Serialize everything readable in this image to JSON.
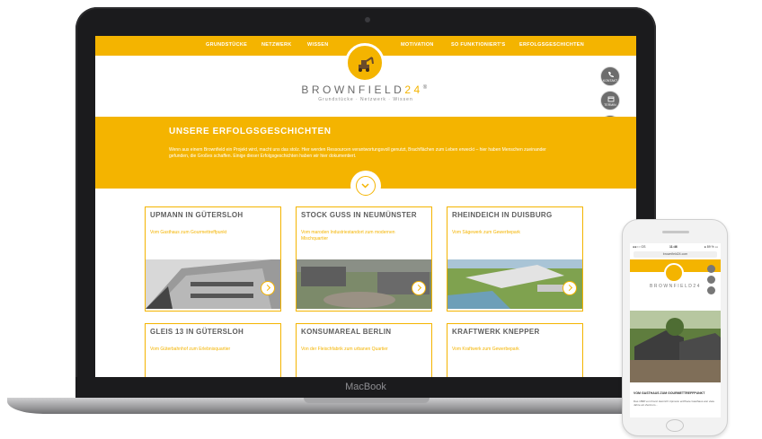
{
  "laptop": {
    "brand": "MacBook"
  },
  "site": {
    "nav": {
      "left": [
        "GRUNDSTÜCKE",
        "NETZWERK",
        "WISSEN"
      ],
      "right": [
        "MOTIVATION",
        "SO FUNKTIONIERT'S",
        "ERFOLGSGESCHICHTEN"
      ]
    },
    "logo": {
      "word": "BROWNFIELD",
      "number": "24",
      "reg": "®",
      "tagline": "Grundstücke · Netzwerk · Wissen"
    },
    "side_buttons": [
      "KONTAKT",
      "TERMIN",
      "LOGIN"
    ],
    "hero": {
      "title": "UNSERE ERFOLGSGESCHICHTEN",
      "text": "Wenn aus einem Brownfield ein Projekt wird, macht uns das stolz. Hier werden Ressourcen verantwortungsvoll genutzt, Brachflächen zum Leben erweckt – hier haben Menschen zueinander gefunden, die Großes schaffen. Einige dieser Erfolgsgeschichten haben wir hier dokumentiert."
    },
    "cards": [
      {
        "title": "UPMANN IN GÜTERSLOH",
        "subtitle": "Vom Gasthaus zum Gourmettreffpunkt"
      },
      {
        "title": "STOCK GUSS IN NEUMÜNSTER",
        "subtitle": "Vom maroden Industriestandort zum modernen Mischquartier"
      },
      {
        "title": "RHEINDEICH IN DUISBURG",
        "subtitle": "Vom Sägewerk zum Gewerbepark"
      },
      {
        "title": "GLEIS 13 IN GÜTERSLOH",
        "subtitle": "Vom Güterbahnhof zum Erlebnisquartier"
      },
      {
        "title": "KONSUMAREAL BERLIN",
        "subtitle": "Von der Fleischfabrik zum urbanen Quartier"
      },
      {
        "title": "KRAFTWERK KNEPPER",
        "subtitle": "Vom Kraftwerk zum Gewerbepark"
      }
    ]
  },
  "phone": {
    "status_left": "●●○○ GS",
    "time": "11:46",
    "status_right": "● 89 % ▭",
    "url": "brownfield24.com",
    "wordmark": "BROWNFIELD24",
    "caption": "VOM GASTHAUS ZUM GOURMETTREFFPUNKT",
    "text": "Das 1898 von Franz Heinrich Upmann eröffnete Gasthaus war viele Jahre ein Zentrum..."
  },
  "colors": {
    "accent": "#f4b400",
    "frame": "#1b1b1d"
  }
}
